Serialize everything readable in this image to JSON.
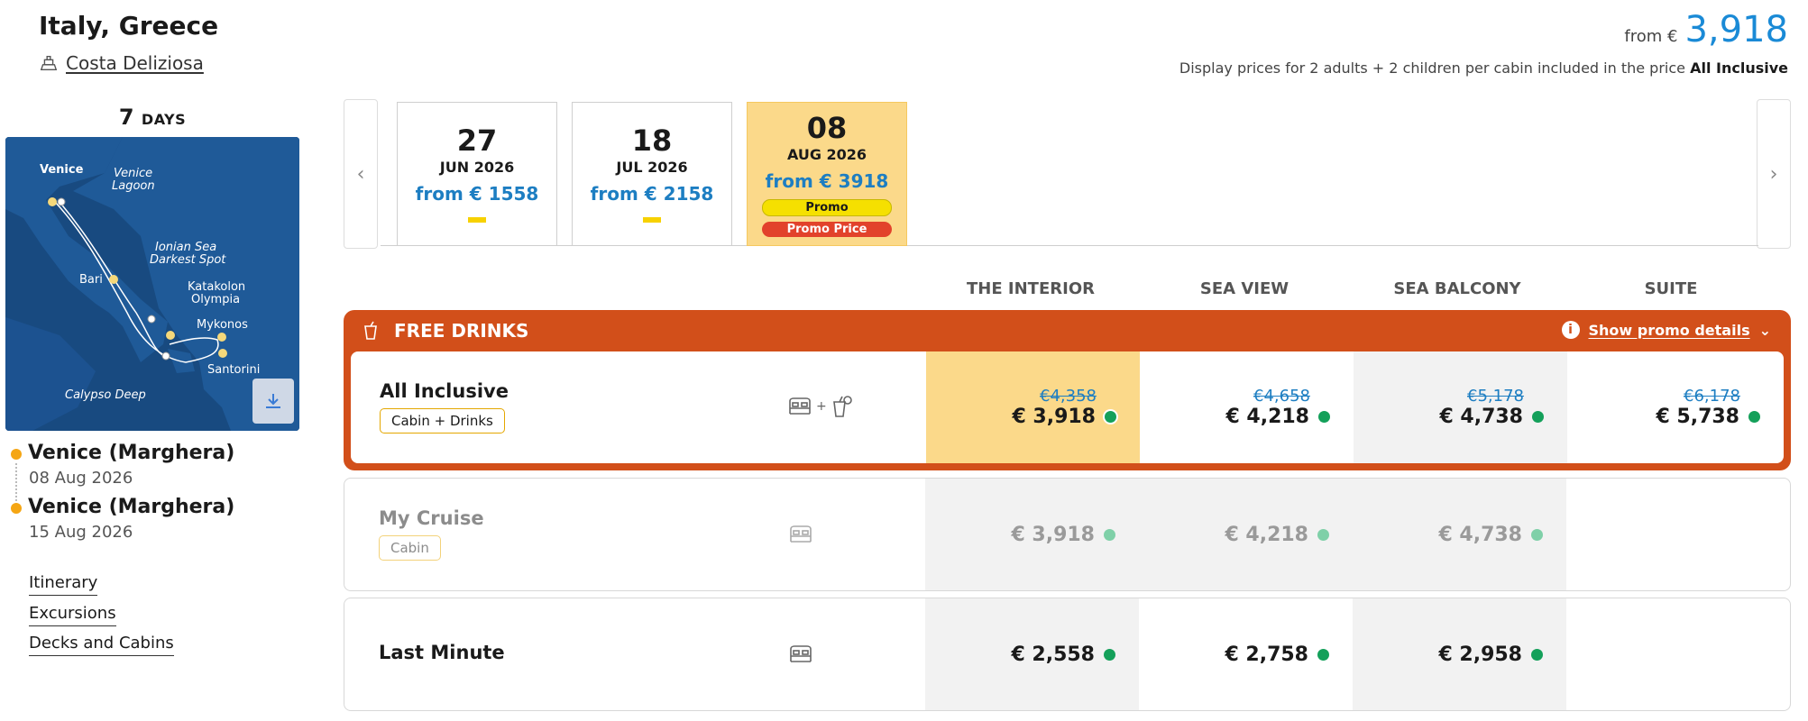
{
  "header": {
    "title": "Italy, Greece",
    "ship": "Costa Deliziosa",
    "price_from_label": "from €",
    "price_from_value": "3,918",
    "price_note": "Display prices for 2 adults + 2 children per cabin included in the price",
    "price_note_bold": "All Inclusive"
  },
  "trip": {
    "days_num": "7",
    "days_unit": "DAYS",
    "map_labels": [
      "Venice",
      "Venice Lagoon",
      "Ionian Sea Darkest Spot",
      "Bari",
      "Katakolon Olympia",
      "Mykonos",
      "Santorini",
      "Calypso Deep"
    ],
    "departure": {
      "name": "Venice (Marghera)",
      "date": "08 Aug 2026"
    },
    "arrival": {
      "name": "Venice (Marghera)",
      "date": "15 Aug 2026"
    }
  },
  "side_links": [
    "Itinerary",
    "Excursions",
    "Decks and Cabins"
  ],
  "dates": [
    {
      "day": "27",
      "month": "JUN 2026",
      "from": "from € 1558"
    },
    {
      "day": "18",
      "month": "JUL 2026",
      "from": "from € 2158"
    },
    {
      "day": "08",
      "month": "AUG 2026",
      "from": "from € 3918",
      "promo": "Promo",
      "promo_price": "Promo Price"
    }
  ],
  "columns": [
    "THE INTERIOR",
    "SEA VIEW",
    "SEA BALCONY",
    "SUITE"
  ],
  "promo": {
    "label": "FREE DRINKS",
    "details_link": "Show promo details"
  },
  "fares": [
    {
      "name": "All Inclusive",
      "tag": "Cabin + Drinks",
      "plus": "+",
      "prices": [
        {
          "old": "€4,358",
          "cur": "€ 3,918"
        },
        {
          "old": "€4,658",
          "cur": "€ 4,218"
        },
        {
          "old": "€5,178",
          "cur": "€ 4,738"
        },
        {
          "old": "€6,178",
          "cur": "€ 5,738"
        }
      ]
    },
    {
      "name": "My Cruise",
      "tag": "Cabin",
      "prices": [
        {
          "cur": "€ 3,918"
        },
        {
          "cur": "€ 4,218"
        },
        {
          "cur": "€ 4,738"
        }
      ]
    },
    {
      "name": "Last Minute",
      "prices": [
        {
          "cur": "€ 2,558"
        },
        {
          "cur": "€ 2,758"
        },
        {
          "cur": "€ 2,958"
        }
      ]
    }
  ],
  "colors": {
    "accent_blue": "#1a8ad6",
    "promo_orange": "#d24f1a",
    "selected_yellow": "#fbd98a",
    "available_green": "#14a05a",
    "map_sea": "#184a80"
  }
}
